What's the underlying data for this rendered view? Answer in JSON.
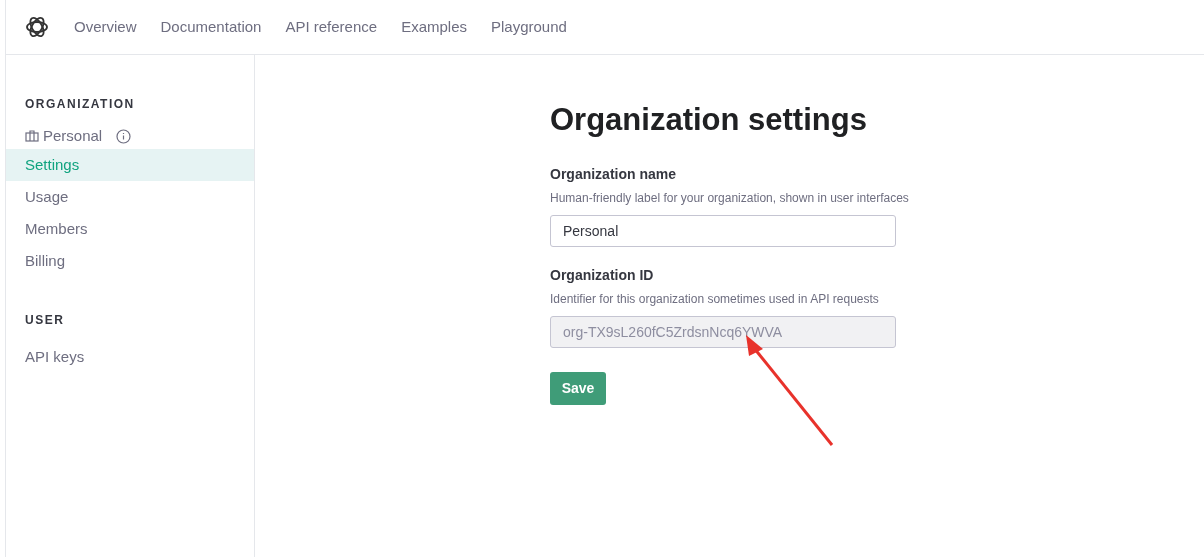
{
  "nav": [
    {
      "label": "Overview"
    },
    {
      "label": "Documentation"
    },
    {
      "label": "API reference"
    },
    {
      "label": "Examples"
    },
    {
      "label": "Playground"
    }
  ],
  "sidebar": {
    "sections": [
      {
        "heading": "ORGANIZATION",
        "org": "Personal",
        "items": [
          {
            "label": "Settings",
            "selected": true
          },
          {
            "label": "Usage",
            "selected": false
          },
          {
            "label": "Members",
            "selected": false
          },
          {
            "label": "Billing",
            "selected": false
          }
        ]
      },
      {
        "heading": "USER",
        "items": [
          {
            "label": "API keys",
            "selected": false
          }
        ]
      }
    ]
  },
  "page": {
    "title": "Organization settings",
    "fields": [
      {
        "label": "Organization name",
        "help": "Human-friendly label for your organization, shown in user interfaces",
        "value": "Personal",
        "disabled": false
      },
      {
        "label": "Organization ID",
        "help": "Identifier for this organization sometimes used in API requests",
        "value": "org-TX9sL260fC5ZrdsnNcq6YWVA",
        "disabled": true
      }
    ],
    "button": "Save"
  }
}
